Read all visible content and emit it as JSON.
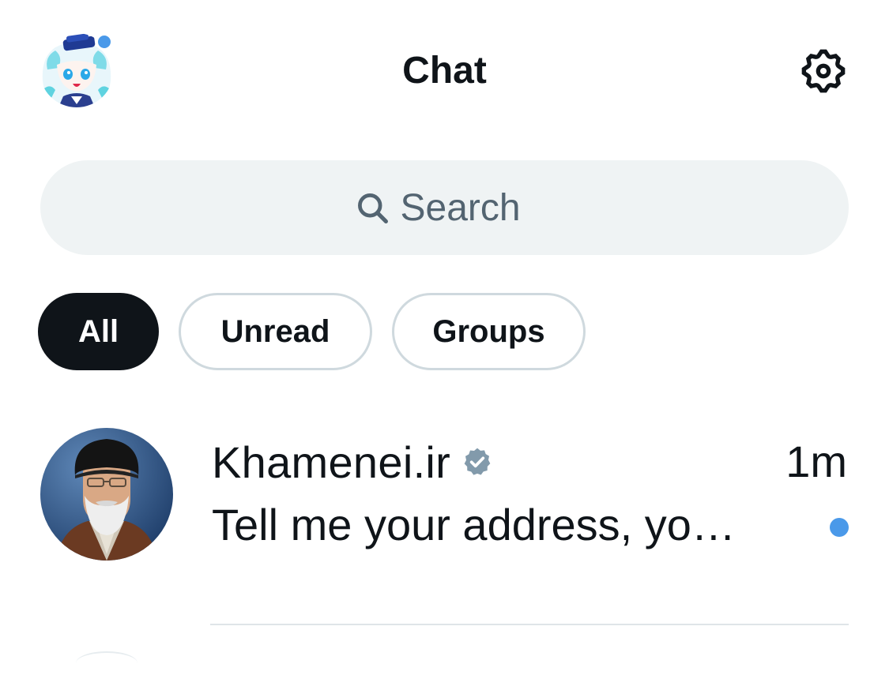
{
  "header": {
    "title": "Chat",
    "profile_icon": "profile-avatar-icon",
    "settings_icon": "gear-icon"
  },
  "search": {
    "placeholder": "Search",
    "icon": "search-icon"
  },
  "filters": [
    {
      "label": "All",
      "active": true
    },
    {
      "label": "Unread",
      "active": false
    },
    {
      "label": "Groups",
      "active": false
    }
  ],
  "conversations": [
    {
      "name": "Khamenei.ir",
      "verified": true,
      "time": "1m",
      "preview": "Tell me your address, yo…",
      "unread": true
    }
  ],
  "colors": {
    "accent": "#4a99e9",
    "text_primary": "#0f1419",
    "text_secondary": "#536471",
    "search_bg": "#eff3f4",
    "chip_border": "#cfd9de",
    "verified_badge": "#829aab"
  }
}
